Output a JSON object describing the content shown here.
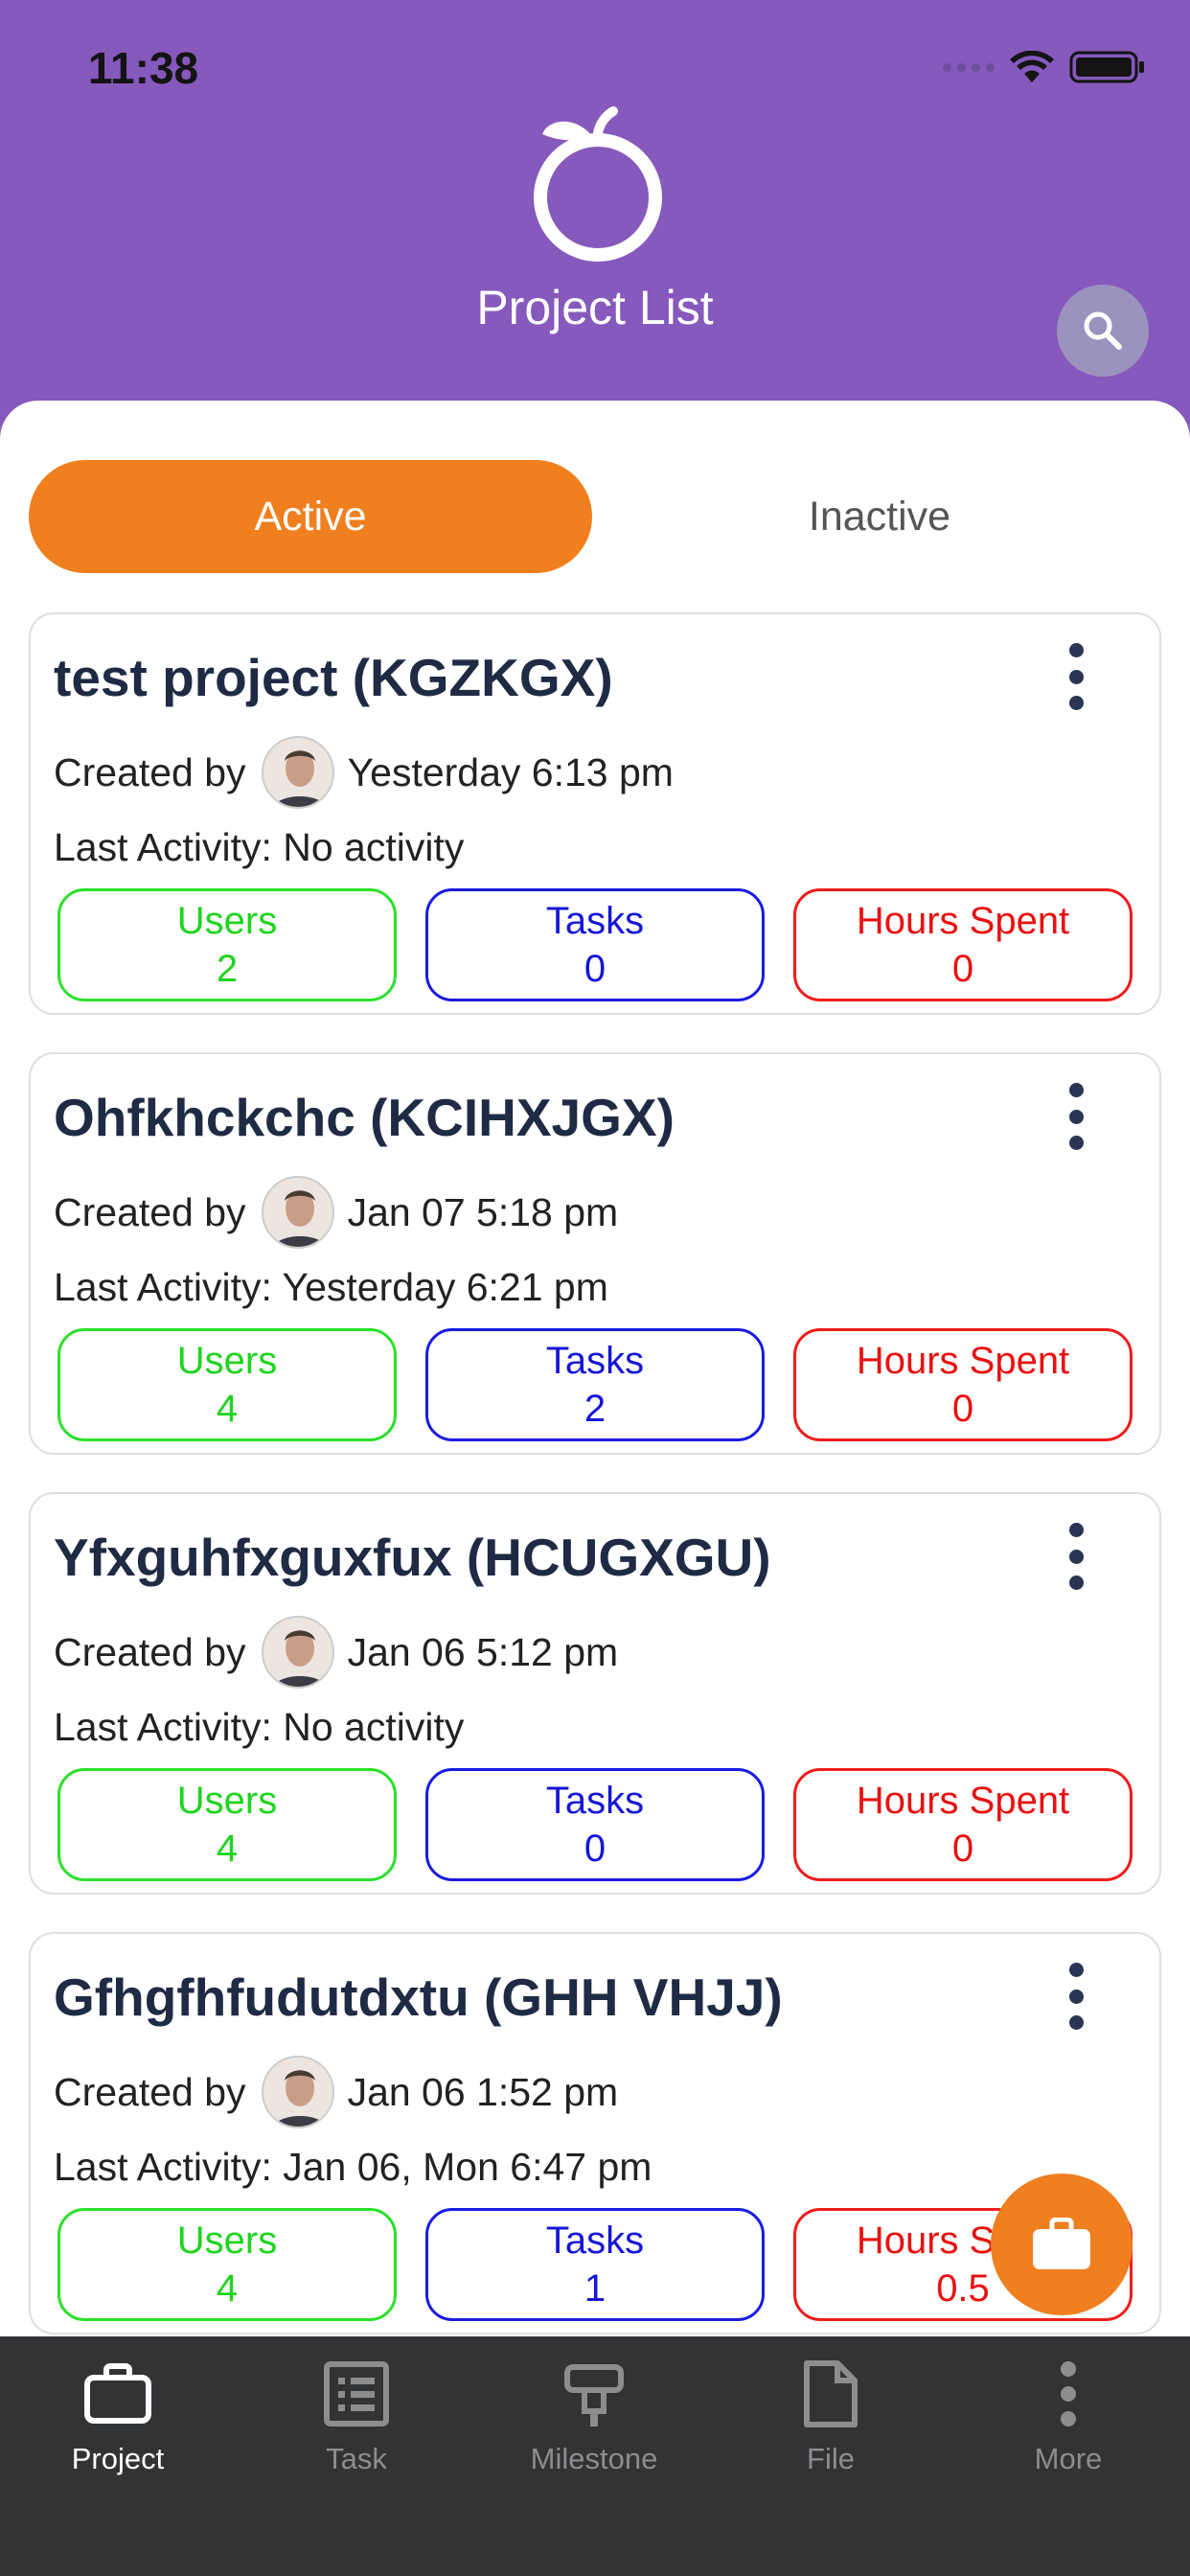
{
  "status_bar": {
    "time": "11:38"
  },
  "header": {
    "title": "Project List"
  },
  "segments": {
    "active_label": "Active",
    "inactive_label": "Inactive"
  },
  "colors": {
    "brand_purple": "#8659BC",
    "accent_orange": "#EF7F1F",
    "users_green": "#1FD41F",
    "tasks_blue": "#1616D6",
    "hours_red": "#E81010",
    "tabbar_dark": "#313335"
  },
  "projects": [
    {
      "title": "test project (KGZKGX)",
      "created_label": "Created by",
      "created_at": "Yesterday 6:13 pm",
      "last_activity": "Last Activity: No activity",
      "users_label": "Users",
      "users": "2",
      "tasks_label": "Tasks",
      "tasks": "0",
      "hours_label": "Hours Spent",
      "hours": "0"
    },
    {
      "title": "Ohfkhckchc (KCIHXJGX)",
      "created_label": "Created by",
      "created_at": "Jan 07 5:18 pm",
      "last_activity": "Last Activity: Yesterday 6:21 pm",
      "users_label": "Users",
      "users": "4",
      "tasks_label": "Tasks",
      "tasks": "2",
      "hours_label": "Hours Spent",
      "hours": "0"
    },
    {
      "title": "Yfxguhfxguxfux (HCUGXGU)",
      "created_label": "Created by",
      "created_at": "Jan 06 5:12 pm",
      "last_activity": "Last Activity: No activity",
      "users_label": "Users",
      "users": "4",
      "tasks_label": "Tasks",
      "tasks": "0",
      "hours_label": "Hours Spent",
      "hours": "0"
    },
    {
      "title": "Gfhgfhfudutdxtu (GHH VHJJ)",
      "created_label": "Created by",
      "created_at": "Jan 06 1:52 pm",
      "last_activity": "Last Activity: Jan 06, Mon 6:47 pm",
      "users_label": "Users",
      "users": "4",
      "tasks_label": "Tasks",
      "tasks": "1",
      "hours_label": "Hours Spent",
      "hours": "0.5"
    }
  ],
  "tabbar": {
    "items": [
      {
        "label": "Project",
        "icon": "briefcase-icon",
        "active": true
      },
      {
        "label": "Task",
        "icon": "task-list-icon",
        "active": false
      },
      {
        "label": "Milestone",
        "icon": "milestone-icon",
        "active": false
      },
      {
        "label": "File",
        "icon": "file-icon",
        "active": false
      },
      {
        "label": "More",
        "icon": "more-icon",
        "active": false
      }
    ]
  }
}
